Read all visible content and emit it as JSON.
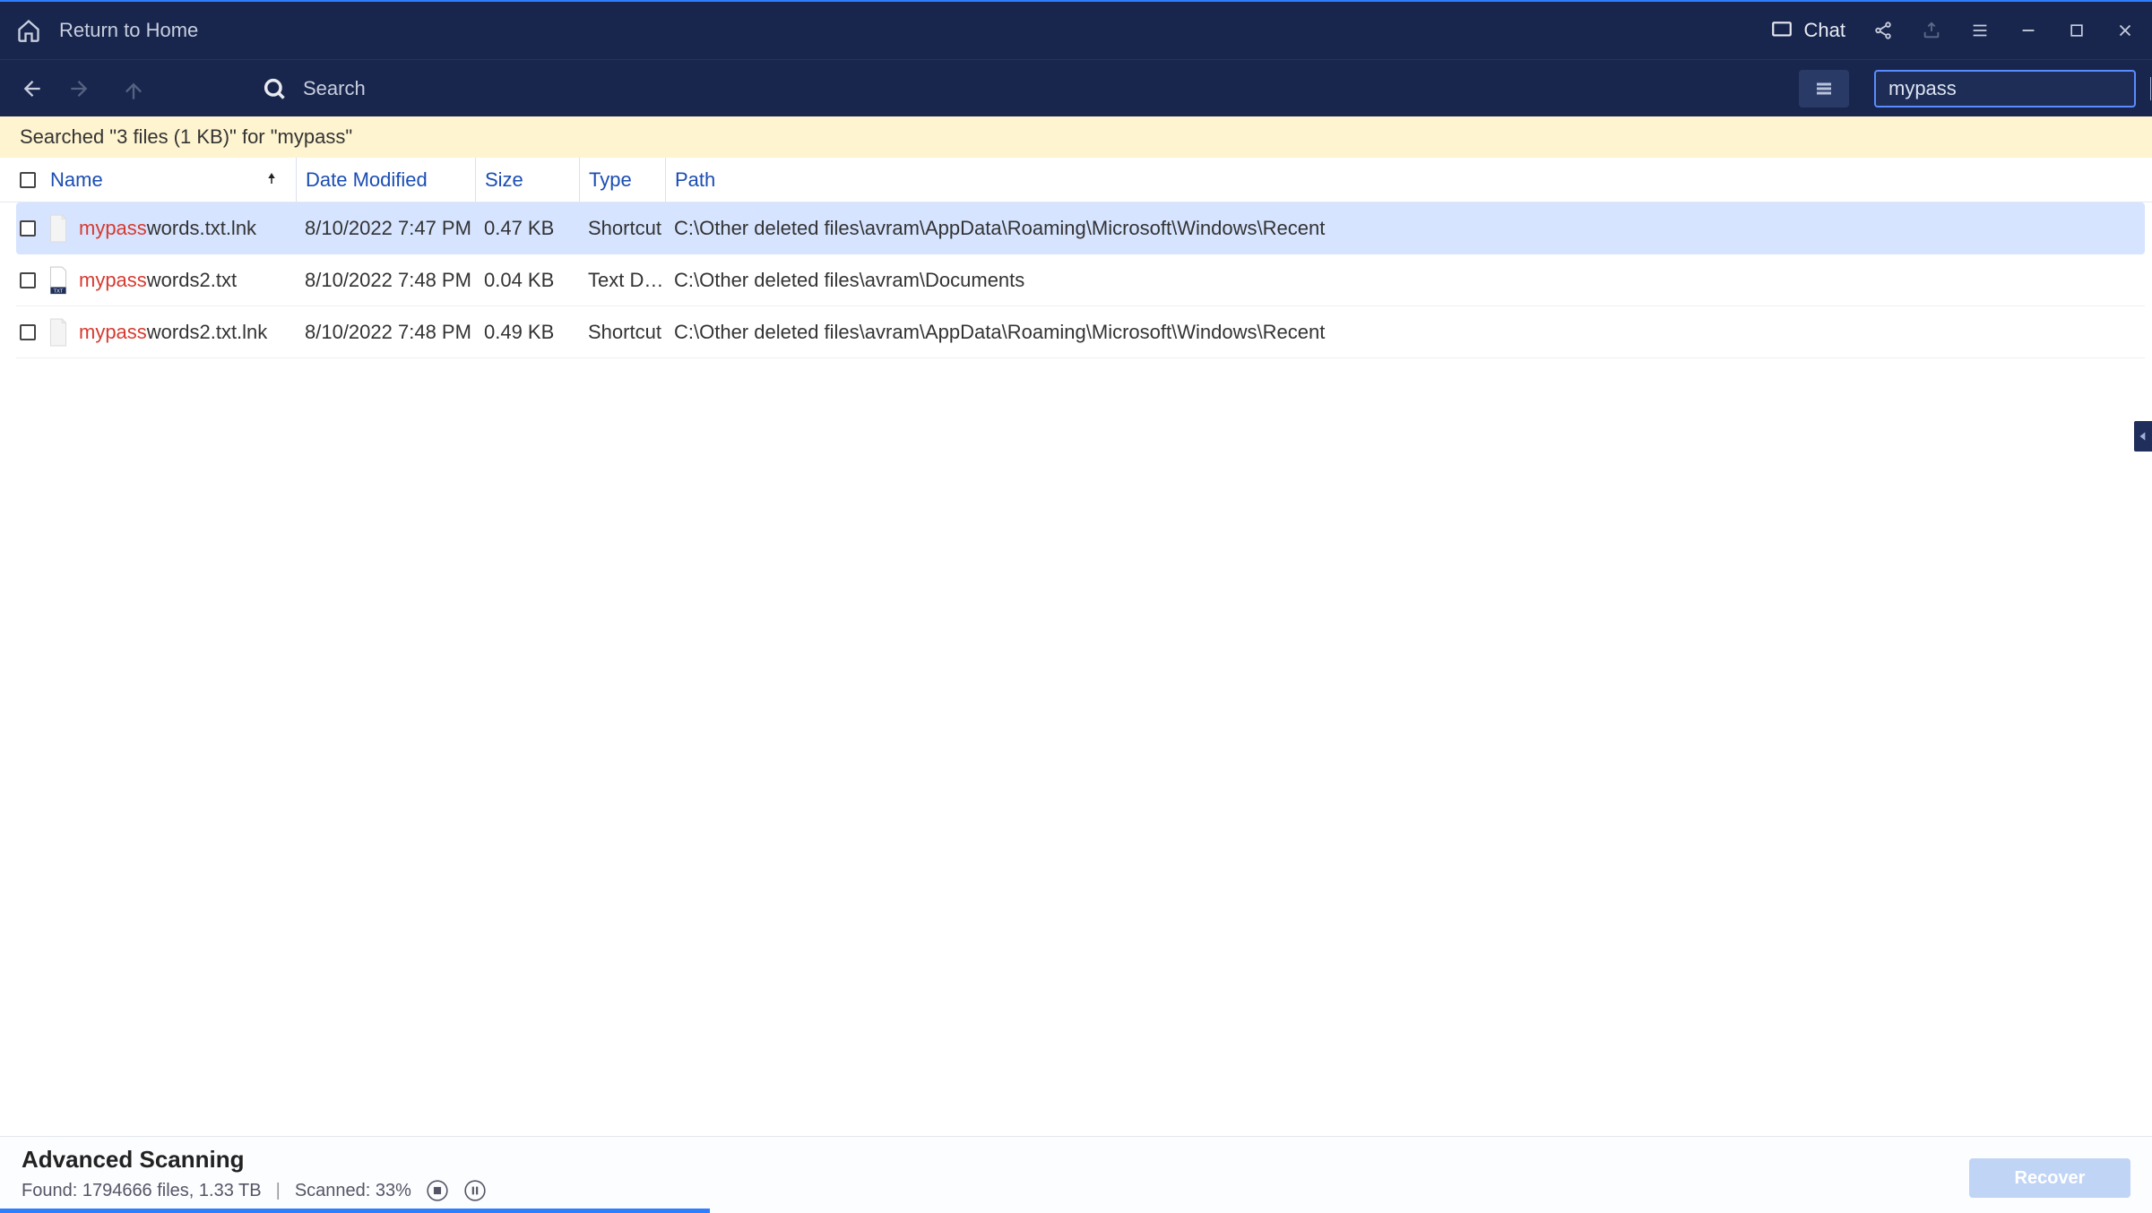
{
  "title_bar": {
    "return_home": "Return to Home",
    "chat": "Chat"
  },
  "toolbar": {
    "search_label": "Search",
    "search_value": "mypass"
  },
  "status": {
    "text": "Searched \"3 files (1 KB)\" for \"mypass\""
  },
  "columns": {
    "name": "Name",
    "date": "Date Modified",
    "size": "Size",
    "type": "Type",
    "path": "Path"
  },
  "highlight": "mypass",
  "rows": [
    {
      "name": "mypasswords.txt.lnk",
      "date": "8/10/2022 7:47 PM",
      "size": "0.47 KB",
      "type": "Shortcut",
      "path": "C:\\Other deleted files\\avram\\AppData\\Roaming\\Microsoft\\Windows\\Recent",
      "icon": "blank",
      "selected": true
    },
    {
      "name": "mypasswords2.txt",
      "date": "8/10/2022 7:48 PM",
      "size": "0.04 KB",
      "type": "Text Docu...",
      "path": "C:\\Other deleted files\\avram\\Documents",
      "icon": "txt",
      "selected": false
    },
    {
      "name": "mypasswords2.txt.lnk",
      "date": "8/10/2022 7:48 PM",
      "size": "0.49 KB",
      "type": "Shortcut",
      "path": "C:\\Other deleted files\\avram\\AppData\\Roaming\\Microsoft\\Windows\\Recent",
      "icon": "blank",
      "selected": false
    }
  ],
  "footer": {
    "title": "Advanced Scanning",
    "found_label": "Found: 1794666 files, 1.33 TB",
    "scanned_label": "Scanned: 33%",
    "recover": "Recover",
    "progress_pct": 33
  }
}
